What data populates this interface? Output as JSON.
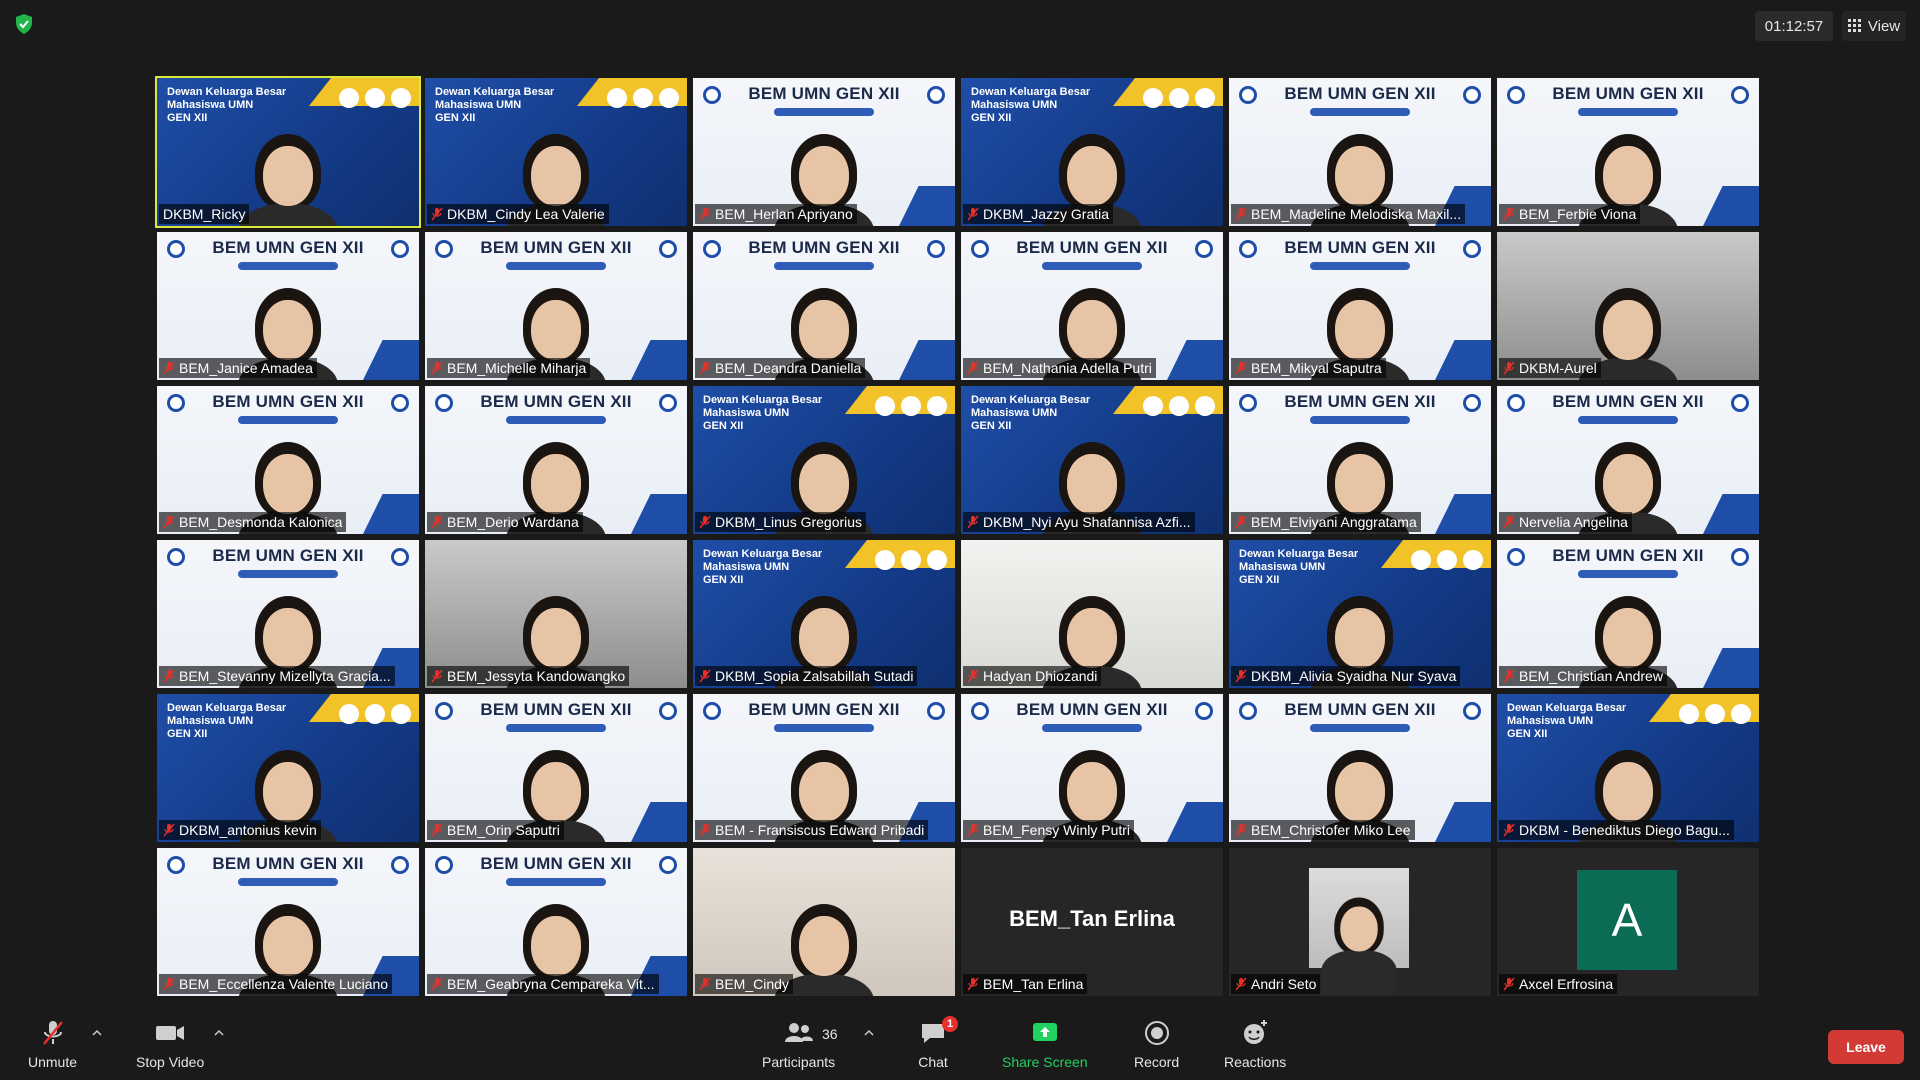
{
  "meeting": {
    "timer": "01:12:57",
    "view_label": "View"
  },
  "participants": [
    {
      "name": "DKBM_Ricky",
      "bg": "blue",
      "highlight": true
    },
    {
      "name": "DKBM_Cindy Lea Valerie",
      "bg": "blue"
    },
    {
      "name": "BEM_Herlan Apriyano",
      "bg": "white"
    },
    {
      "name": "DKBM_Jazzy Gratia",
      "bg": "blue"
    },
    {
      "name": "BEM_Madeline Melodiska Maxil...",
      "bg": "white"
    },
    {
      "name": "BEM_Ferbie Viona",
      "bg": "white"
    },
    {
      "name": "BEM_Janice Amadea",
      "bg": "white"
    },
    {
      "name": "BEM_Michelle Miharja",
      "bg": "white"
    },
    {
      "name": "BEM_Deandra Daniella",
      "bg": "white"
    },
    {
      "name": "BEM_Nathania Adella Putri",
      "bg": "white"
    },
    {
      "name": "BEM_Mikyal Saputra",
      "bg": "white"
    },
    {
      "name": "DKBM-Aurel",
      "bg": "gray"
    },
    {
      "name": "BEM_Desmonda Kalonica",
      "bg": "white"
    },
    {
      "name": "BEM_Derio Wardana",
      "bg": "white"
    },
    {
      "name": "DKBM_Linus Gregorius",
      "bg": "blue"
    },
    {
      "name": "DKBM_Nyi Ayu Shafannisa Azfi...",
      "bg": "blue"
    },
    {
      "name": "BEM_Elviyani Anggratama",
      "bg": "white"
    },
    {
      "name": "Nervelia Angelina",
      "bg": "white"
    },
    {
      "name": "BEM_Stevanny Mizellyta Gracia...",
      "bg": "white"
    },
    {
      "name": "BEM_Jessyta Kandowangko",
      "bg": "gray"
    },
    {
      "name": "DKBM_Sopia Zalsabillah Sutadi",
      "bg": "blue"
    },
    {
      "name": "Hadyan Dhiozandi",
      "bg": "office"
    },
    {
      "name": "DKBM_Alivia Syaidha Nur Syava",
      "bg": "blue"
    },
    {
      "name": "BEM_Christian Andrew",
      "bg": "white"
    },
    {
      "name": "DKBM_antonius kevin",
      "bg": "blue"
    },
    {
      "name": "BEM_Orin Saputri",
      "bg": "white"
    },
    {
      "name": "BEM - Fransiscus Edward Pribadi",
      "bg": "white"
    },
    {
      "name": "BEM_Fensy Winly Putri",
      "bg": "white"
    },
    {
      "name": "BEM_Christofer Miko Lee",
      "bg": "white"
    },
    {
      "name": "DKBM - Benediktus Diego Bagu...",
      "bg": "blue"
    },
    {
      "name": "BEM_Eccellenza Valente Luciano",
      "bg": "white"
    },
    {
      "name": "BEM_Geabryna Cempareka Vit...",
      "bg": "white"
    },
    {
      "name": "BEM_Cindy",
      "bg": "room"
    },
    {
      "name": "BEM_Tan Erlina",
      "bg": "dark",
      "display_name": "BEM_Tan Erlina"
    },
    {
      "name": "Andri Seto",
      "bg": "dark",
      "photo": true
    },
    {
      "name": "Axcel Erfrosina",
      "bg": "dark",
      "initial": "A"
    }
  ],
  "banner_text": {
    "bem": "BEM UMN GEN XII",
    "dewan_line1": "Dewan Keluarga Besar",
    "dewan_line2": "Mahasiswa UMN",
    "dewan_line3": "GEN XII"
  },
  "toolbar": {
    "unmute": "Unmute",
    "stop_video": "Stop Video",
    "participants": "Participants",
    "participants_count": "36",
    "chat": "Chat",
    "chat_badge": "1",
    "share_screen": "Share Screen",
    "record": "Record",
    "reactions": "Reactions",
    "leave": "Leave"
  },
  "colors": {
    "accent_green": "#23d160",
    "leave_red": "#d23b35",
    "active_speaker": "#d9e83a"
  }
}
